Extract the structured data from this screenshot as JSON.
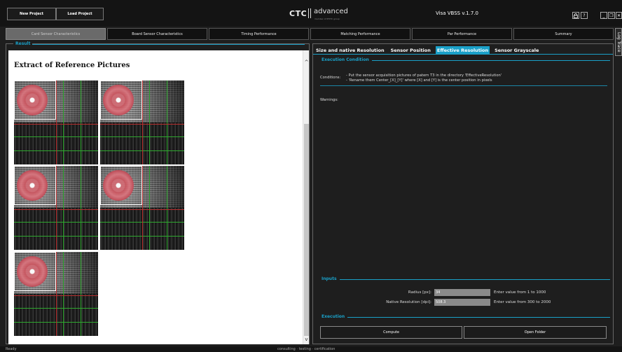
{
  "topbar": {
    "new_project": "New Project",
    "load_project": "Load Project",
    "logo_ctc": "CTC",
    "logo_advanced": "advanced",
    "logo_sub": "member of PHITC group",
    "version": "Visa VBSS v.1.7.0",
    "lock_icon": "lock-icon",
    "help": "?",
    "minimize": "_",
    "restore": "❐",
    "close": "✕"
  },
  "tabs": [
    {
      "label": "Card Sensor Characteristics",
      "active": true
    },
    {
      "label": "Board Sensor Characteristics",
      "active": false
    },
    {
      "label": "Timing Performance",
      "active": false
    },
    {
      "label": "Matching Performance",
      "active": false
    },
    {
      "label": "Par Performance",
      "active": false
    },
    {
      "label": "Summary",
      "active": false
    }
  ],
  "log_trace": "Log Trace",
  "result": {
    "legend": "Result",
    "title": "Extract of Reference Pictures"
  },
  "right": {
    "subtabs": [
      {
        "label": "Size and native Resolution",
        "active": false
      },
      {
        "label": "Sensor Position",
        "active": false
      },
      {
        "label": "Effective Resolution",
        "active": true
      },
      {
        "label": "Sensor Grayscale",
        "active": false
      }
    ],
    "execution_condition": "Execution Condition",
    "conditions_label": "Conditions:",
    "conditions_line1": "- Put the sensor acquisition pictures of patern T3 in the directory 'EffectiveResolution'",
    "conditions_line2": "- 'Rename them Center_[X]_[Y]' where [X] and [Y] is the center position in pixels",
    "warnings_label": "Warnings:",
    "inputs": "Inputs",
    "radius_label": "Radius [px]:",
    "radius_value": "34",
    "radius_hint": "Enter value from 1 to 1000",
    "native_label": "Native Resolution [dpi]:",
    "native_value": "508.3",
    "native_hint": "Enter value from 300 to 2000",
    "execution": "Execution",
    "compute": "Compute",
    "open_folder": "Open Folder"
  },
  "status": {
    "ready": "Ready",
    "footer": "consulting · testing · certification"
  }
}
